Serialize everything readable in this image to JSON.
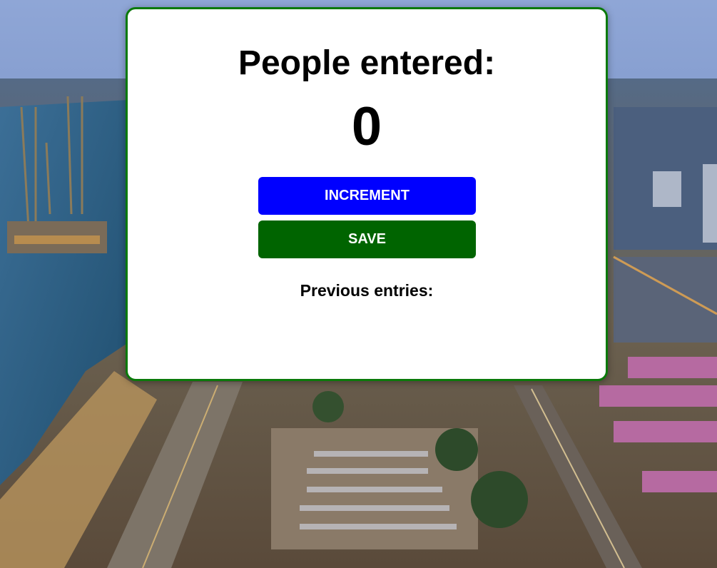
{
  "app": {
    "title": "People entered:",
    "count": "0",
    "buttons": {
      "increment_label": "INCREMENT",
      "save_label": "SAVE"
    },
    "previous_entries_label": "Previous entries:",
    "previous_entries_value": ""
  },
  "colors": {
    "card_border": "#0a7a0a",
    "increment_button": "#0000ff",
    "save_button": "#006400",
    "card_background": "#ffffff"
  }
}
